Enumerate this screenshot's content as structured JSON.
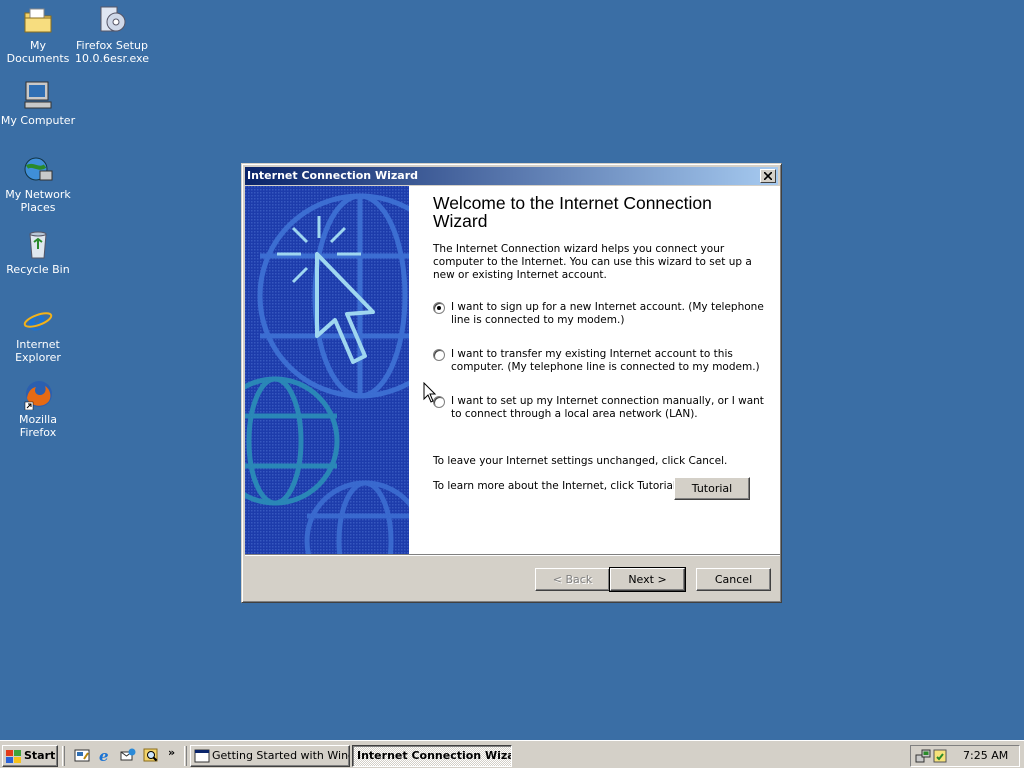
{
  "desktop": {
    "background_color": "#3a6ea5",
    "icons": [
      {
        "label": "My Documents",
        "icon": "folder-documents-icon"
      },
      {
        "label": "Firefox Setup 10.0.6esr.exe",
        "icon": "installer-icon"
      },
      {
        "label": "My Computer",
        "icon": "computer-icon"
      },
      {
        "label": "My Network Places",
        "icon": "network-places-icon"
      },
      {
        "label": "Recycle Bin",
        "icon": "recycle-bin-icon"
      },
      {
        "label": "Internet Explorer",
        "icon": "internet-explorer-icon"
      },
      {
        "label": "Mozilla Firefox",
        "icon": "firefox-icon"
      }
    ]
  },
  "wizard": {
    "title": "Internet Connection Wizard",
    "heading": "Welcome to the Internet Connection Wizard",
    "intro": "The Internet Connection wizard helps you connect your computer to the Internet.  You can use this wizard to set up a new or existing Internet account.",
    "options": [
      {
        "label": "I want to sign up for a new Internet account. (My telephone line is connected to my modem.)",
        "selected": true
      },
      {
        "label": "I want to transfer my existing Internet account to this computer. (My telephone line is connected to my modem.)",
        "selected": false
      },
      {
        "label": "I want to set up my Internet connection manually, or I want to connect through a local area network (LAN).",
        "selected": false
      }
    ],
    "leave_text": "To leave your Internet settings unchanged, click Cancel.",
    "learn_text": "To learn more about the Internet, click Tutorial.",
    "tutorial_button": "Tutorial",
    "back_button": "< Back",
    "next_button": "Next >",
    "cancel_button": "Cancel"
  },
  "taskbar": {
    "start_label": "Start",
    "quick_launch": [
      "show-desktop-icon",
      "internet-explorer-icon",
      "outlook-express-icon",
      "search-icon"
    ],
    "overflow": "»",
    "tasks": [
      {
        "label": "Getting Started with Wind...",
        "active": false
      },
      {
        "label": "Internet Connection Wiza...",
        "active": true
      }
    ],
    "clock": "7:25 AM"
  }
}
